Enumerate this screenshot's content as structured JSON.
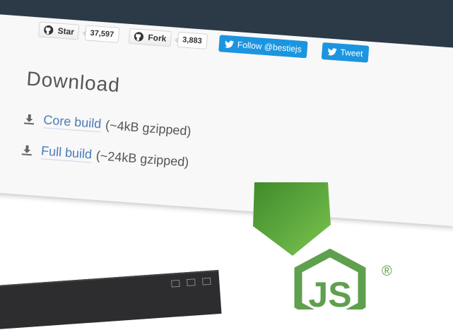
{
  "github": {
    "star_label": "Star",
    "star_count": "37,597",
    "fork_label": "Fork",
    "fork_count": "3,883"
  },
  "twitter": {
    "follow_label": "Follow @bestiejs",
    "tweet_label": "Tweet"
  },
  "download": {
    "heading": "Download",
    "core_link": "Core build",
    "core_size": "(~4kB gzipped)",
    "full_link": "Full build",
    "full_size": "(~24kB gzipped)"
  },
  "logos": {
    "node_js": "JS",
    "registered": "®"
  },
  "colors": {
    "topbar": "#2b3a46",
    "link": "#4a7bb8",
    "twitter": "#1b95e0",
    "node_green": "#6cc24a"
  }
}
